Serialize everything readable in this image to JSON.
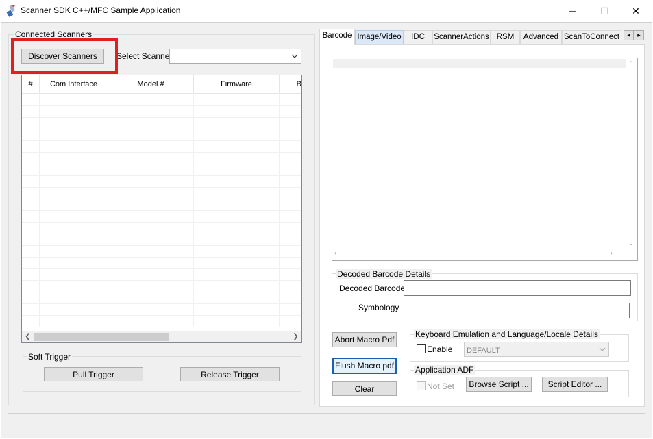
{
  "window": {
    "title": "Scanner SDK C++/MFC Sample Application",
    "minimize_glyph": "—",
    "maximize_glyph": "☐",
    "close_glyph": "✕"
  },
  "left": {
    "connected_label": "Connected Scanners",
    "discover_label": "Discover Scanners",
    "select_scanner_label": "Select Scanner",
    "select_scanner_value": "",
    "columns": [
      "#",
      "Com Interface",
      "Model #",
      "Firmware",
      "B"
    ],
    "soft_trigger_label": "Soft Trigger",
    "pull_trigger_label": "Pull Trigger",
    "release_trigger_label": "Release Trigger"
  },
  "tabs": [
    "Barcode",
    "Image/Video",
    "IDC",
    "ScannerActions",
    "RSM",
    "Advanced",
    "ScanToConnect"
  ],
  "tab_scroll": {
    "left": "◂",
    "right": "▸"
  },
  "barcode": {
    "decoded_details_label": "Decoded Barcode Details",
    "decoded_barcode_label": "Decoded Barcode",
    "decoded_barcode_value": "",
    "symbology_label": "Symbology",
    "symbology_value": "",
    "abort_macro_label": "Abort Macro Pdf",
    "flush_macro_label": "Flush Macro  pdf",
    "clear_label": "Clear",
    "keyboard_group_label": "Keyboard Emulation and Language/Locale Details",
    "enable_label": "Enable",
    "locale_value": "DEFAULT",
    "adf_group_label": "Application ADF",
    "not_set_label": "Not Set",
    "browse_script_label": "Browse Script ...",
    "script_editor_label": "Script Editor ..."
  },
  "colors": {
    "highlight": "#e01f1f",
    "window_bg": "#f0f0f0",
    "tab_hover": "#dbe8f7"
  }
}
